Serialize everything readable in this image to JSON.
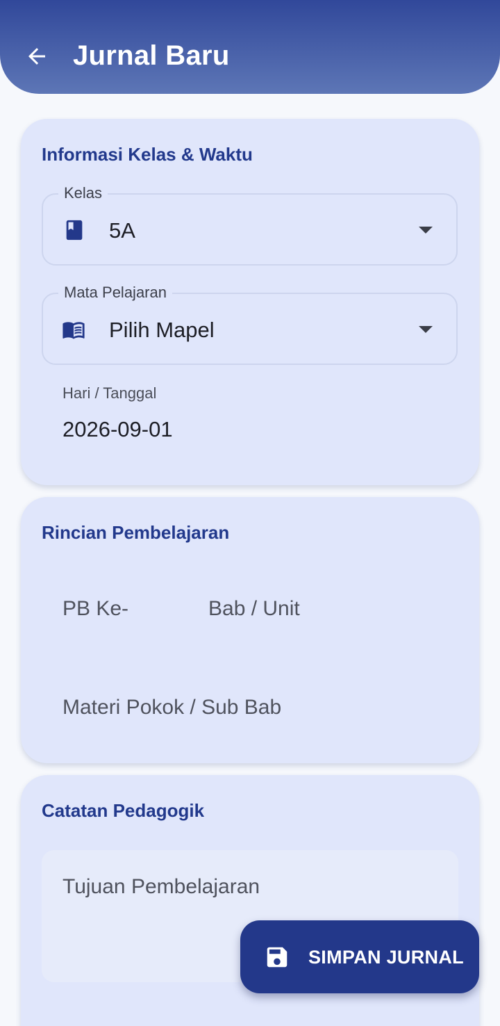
{
  "header": {
    "title": "Jurnal Baru",
    "back_icon": "arrow-left-icon"
  },
  "class_info": {
    "title": "Informasi Kelas & Waktu",
    "kelas": {
      "label": "Kelas",
      "value": "5A",
      "icon": "book-icon"
    },
    "mapel": {
      "label": "Mata Pelajaran",
      "value": "Pilih Mapel",
      "icon": "open-book-icon"
    },
    "tanggal": {
      "label": "Hari / Tanggal",
      "value": "2026-09-01"
    }
  },
  "learning_details": {
    "title": "Rincian Pembelajaran",
    "pb_placeholder": "PB Ke-",
    "bab_placeholder": "Bab / Unit",
    "materi_placeholder": "Materi Pokok / Sub Bab"
  },
  "pedagogic_notes": {
    "title": "Catatan Pedagogik",
    "tujuan_placeholder": "Tujuan Pembelajaran"
  },
  "fab": {
    "label": "SIMPAN JURNAL",
    "icon": "save-icon"
  },
  "colors": {
    "primary": "#23388a",
    "card": "#e0e6fb",
    "background": "#f6f8fc"
  }
}
